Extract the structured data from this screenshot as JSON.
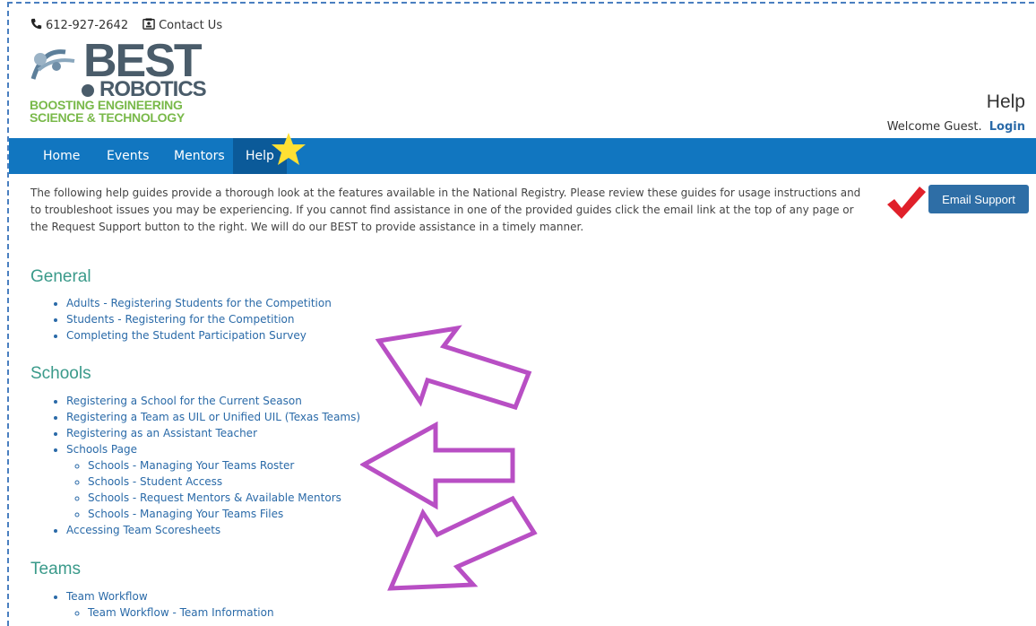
{
  "contact_bar": {
    "phone": "612-927-2642",
    "contact_label": "Contact Us"
  },
  "logo": {
    "line1": "BEST",
    "line2": "ROBOTICS",
    "tagline1": "BOOSTING ENGINEERING",
    "tagline2": "SCIENCE & TECHNOLOGY"
  },
  "header": {
    "page_title": "Help",
    "welcome_text": "Welcome Guest.",
    "login_label": "Login"
  },
  "nav": {
    "items": [
      "Home",
      "Events",
      "Mentors",
      "Help"
    ],
    "active": "Help"
  },
  "intro_text": "The following help guides provide a thorough look at the features available in the National Registry. Please review these guides for usage instructions and to troubleshoot issues you may be experiencing. If you cannot find assistance in one of the provided guides click the email link at the top of any page or the Request Support button to the right. We will do our BEST to provide assistance in a timely manner.",
  "email_support_label": "Email Support",
  "sections": {
    "general": {
      "title": "General",
      "links": [
        "Adults - Registering Students for the Competition",
        "Students - Registering for the Competition",
        "Completing the Student Participation Survey"
      ]
    },
    "schools": {
      "title": "Schools",
      "links": [
        "Registering a School for the Current Season",
        "Registering a Team as UIL or Unified UIL (Texas Teams)",
        "Registering as an Assistant Teacher",
        "Schools Page",
        "Accessing Team Scoresheets"
      ],
      "sublinks": [
        "Schools - Managing Your Teams Roster",
        "Schools - Student Access",
        "Schools - Request Mentors & Available Mentors",
        "Schools - Managing Your Teams Files"
      ]
    },
    "teams": {
      "title": "Teams",
      "links": [
        "Team Workflow"
      ],
      "sublinks": [
        "Team Workflow - Team Information"
      ]
    }
  },
  "colors": {
    "nav_bg": "#1176c0",
    "link": "#2a6aa8",
    "section_title": "#3a9a8a",
    "button": "#2e6ea6",
    "annotation_arrow": "#b84fc4",
    "annotation_star": "#ffe033",
    "annotation_check": "#e0202a"
  }
}
